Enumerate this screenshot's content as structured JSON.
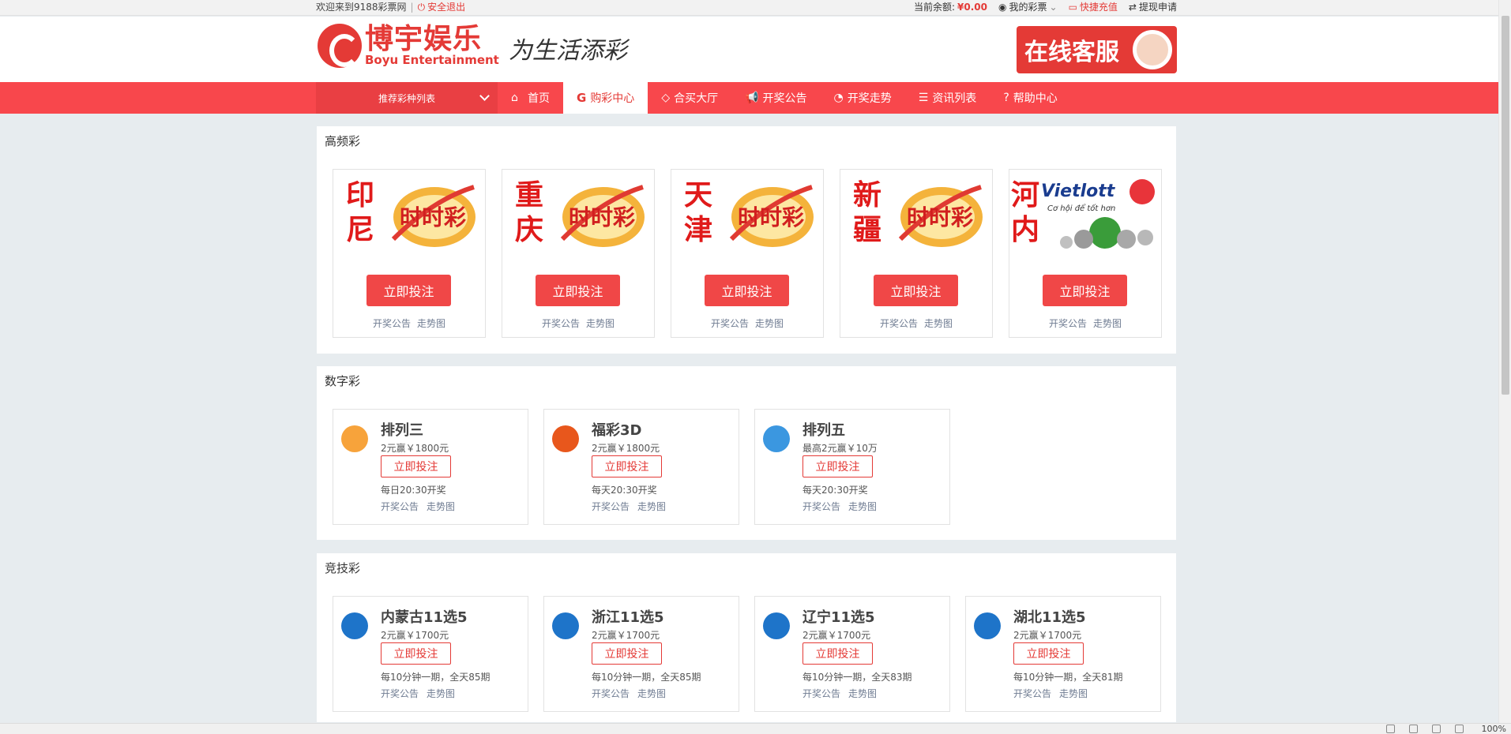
{
  "topbar": {
    "welcome": "欢迎来到9188彩票网",
    "logout": "安全退出",
    "balance_label": "当前余额:",
    "balance_value": "¥0.00",
    "my_lottery": "我的彩票",
    "recharge": "快捷充值",
    "withdraw": "提现申请"
  },
  "header": {
    "brand_cn": "博宇娱乐",
    "brand_en": "Boyu Entertainment",
    "slogan": "为生活添彩",
    "service": "在线客服"
  },
  "nav": {
    "dropdown": "推荐彩种列表",
    "items": [
      "首页",
      "购彩中心",
      "合买大厅",
      "开奖公告",
      "开奖走势",
      "资讯列表",
      "帮助中心"
    ]
  },
  "sections": [
    {
      "title": "高频彩",
      "cards": [
        {
          "name": "印尼",
          "image": "时时彩",
          "button": "立即投注",
          "links": [
            "开奖公告",
            "走势图"
          ]
        },
        {
          "name": "重庆",
          "image": "时时彩",
          "button": "立即投注",
          "links": [
            "开奖公告",
            "走势图"
          ]
        },
        {
          "name": "天津",
          "image": "时时彩",
          "button": "立即投注",
          "links": [
            "开奖公告",
            "走势图"
          ]
        },
        {
          "name": "新疆",
          "image": "时时彩",
          "button": "立即投注",
          "links": [
            "开奖公告",
            "走势图"
          ]
        },
        {
          "name": "河内",
          "image": "Vietlott",
          "image_sub": "Cơ hội để tốt hơn",
          "button": "立即投注",
          "links": [
            "开奖公告",
            "走势图"
          ]
        }
      ]
    },
    {
      "title": "数字彩",
      "cards": [
        {
          "title": "排列三",
          "price": "2元赢￥1800元",
          "button": "立即投注",
          "time": "每日20:30开奖",
          "links": [
            "开奖公告",
            "走势图"
          ],
          "color": "#f7a33b"
        },
        {
          "title": "福彩3D",
          "price": "2元赢￥1800元",
          "button": "立即投注",
          "time": "每天20:30开奖",
          "links": [
            "开奖公告",
            "走势图"
          ],
          "color": "#e8571c"
        },
        {
          "title": "排列五",
          "price": "最高2元赢￥10万",
          "button": "立即投注",
          "time": "每天20:30开奖",
          "links": [
            "开奖公告",
            "走势图"
          ],
          "color": "#3b97e0"
        }
      ]
    },
    {
      "title": "竞技彩",
      "cards": [
        {
          "title": "内蒙古11选5",
          "price": "2元赢￥1700元",
          "button": "立即投注",
          "time": "每10分钟一期，全天85期",
          "links": [
            "开奖公告",
            "走势图"
          ],
          "color": "#1e74c9"
        },
        {
          "title": "浙江11选5",
          "price": "2元赢￥1700元",
          "button": "立即投注",
          "time": "每10分钟一期，全天85期",
          "links": [
            "开奖公告",
            "走势图"
          ],
          "color": "#1e74c9"
        },
        {
          "title": "辽宁11选5",
          "price": "2元赢￥1700元",
          "button": "立即投注",
          "time": "每10分钟一期，全天83期",
          "links": [
            "开奖公告",
            "走势图"
          ],
          "color": "#1e74c9"
        },
        {
          "title": "湖北11选5",
          "price": "2元赢￥1700元",
          "button": "立即投注",
          "time": "每10分钟一期，全天81期",
          "links": [
            "开奖公告",
            "走势图"
          ],
          "color": "#1e74c9"
        }
      ]
    }
  ],
  "statusbar": {
    "zoom": "100%"
  },
  "colors": {
    "accent": "#e43a36",
    "nav": "#f8474c",
    "background": "#e7ecef"
  }
}
